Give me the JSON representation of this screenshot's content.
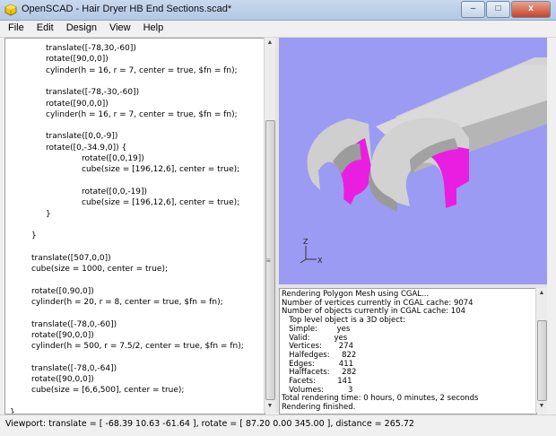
{
  "window": {
    "title": "OpenSCAD - Hair Dryer HB End Sections.scad*",
    "minimize": "–",
    "maximize": "□",
    "close": "x"
  },
  "menu": [
    "File",
    "Edit",
    "Design",
    "View",
    "Help"
  ],
  "editor": {
    "lines": [
      {
        "indent": 1,
        "text": "translate([-78,30,-60])"
      },
      {
        "indent": 1,
        "text": "rotate([90,0,0])"
      },
      {
        "indent": 1,
        "text": "cylinder(h = 16, r = 7, center = true, $fn = fn);"
      },
      {
        "indent": 0,
        "text": ""
      },
      {
        "indent": 1,
        "text": "translate([-78,-30,-60])"
      },
      {
        "indent": 1,
        "text": "rotate([90,0,0])"
      },
      {
        "indent": 1,
        "text": "cylinder(h = 16, r = 7, center = true, $fn = fn);"
      },
      {
        "indent": 0,
        "text": ""
      },
      {
        "indent": 1,
        "text": "translate([0,0,-9])"
      },
      {
        "indent": 1,
        "text": "rotate([0,-34.9,0]) {"
      },
      {
        "indent": 2,
        "text": "rotate([0,0,19])"
      },
      {
        "indent": 2,
        "text": "cube(size = [196,12,6], center = true);"
      },
      {
        "indent": 0,
        "text": ""
      },
      {
        "indent": 2,
        "text": "rotate([0,0,-19])"
      },
      {
        "indent": 2,
        "text": "cube(size = [196,12,6], center = true);"
      },
      {
        "indent": 1,
        "text": "}"
      },
      {
        "indent": 0,
        "text": ""
      },
      {
        "indent": 0.6,
        "text": "}"
      },
      {
        "indent": 0,
        "text": ""
      },
      {
        "indent": 0.6,
        "text": "translate([507,0,0])"
      },
      {
        "indent": 0.6,
        "text": "cube(size = 1000, center = true);"
      },
      {
        "indent": 0,
        "text": ""
      },
      {
        "indent": 0.6,
        "text": "rotate([0,90,0])"
      },
      {
        "indent": 0.6,
        "text": "cylinder(h = 20, r = 8, center = true, $fn = fn);"
      },
      {
        "indent": 0,
        "text": ""
      },
      {
        "indent": 0.6,
        "text": "translate([-78,0,-60])"
      },
      {
        "indent": 0.6,
        "text": "rotate([90,0,0])"
      },
      {
        "indent": 0.6,
        "text": "cylinder(h = 500, r = 7.5/2, center = true, $fn = fn);"
      },
      {
        "indent": 0,
        "text": ""
      },
      {
        "indent": 0.6,
        "text": "translate([-78,0,-64])"
      },
      {
        "indent": 0.6,
        "text": "rotate([90,0,0])"
      },
      {
        "indent": 0.6,
        "text": "cube(size = [6,6,500], center = true);"
      },
      {
        "indent": 0,
        "text": ""
      },
      {
        "indent": 0,
        "text": "}"
      }
    ]
  },
  "viewport": {
    "axes": {
      "z": "Z",
      "x": "X"
    },
    "background": "#9b9bf4",
    "model_color": "#c8c8c8",
    "cut_color": "#e81fe0"
  },
  "console": {
    "lines": [
      "Rendering Polygon Mesh using CGAL...",
      "Number of vertices currently in CGAL cache: 9074",
      "Number of objects currently in CGAL cache: 104",
      "   Top level object is a 3D object:",
      "   Simple:        yes",
      "   Valid:          yes",
      "   Vertices:       274",
      "   Halfedges:     822",
      "   Edges:          411",
      "   Halffacets:     282",
      "   Facets:         141",
      "   Volumes:          3",
      "Total rendering time: 0 hours, 0 minutes, 2 seconds",
      "Rendering finished."
    ]
  },
  "status": {
    "text": "Viewport: translate = [ -68.39 10.63 -61.64 ], rotate = [ 87.20 0.00 345.00 ], distance = 265.72"
  }
}
